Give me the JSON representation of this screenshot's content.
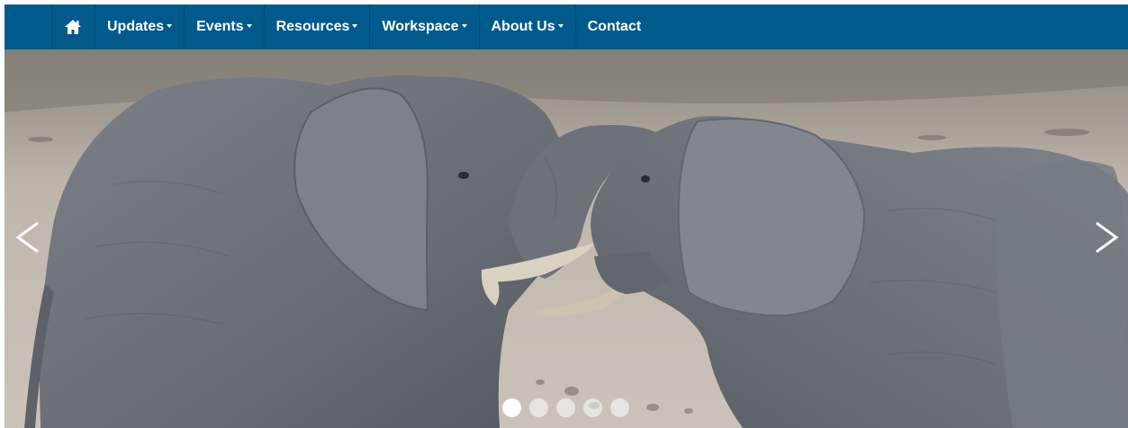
{
  "nav": {
    "home_icon": "home-icon",
    "items": [
      {
        "label": "Updates",
        "dropdown": true
      },
      {
        "label": "Events",
        "dropdown": true
      },
      {
        "label": "Resources",
        "dropdown": true
      },
      {
        "label": "Workspace",
        "dropdown": true
      },
      {
        "label": "About Us",
        "dropdown": true
      },
      {
        "label": "Contact",
        "dropdown": false
      }
    ]
  },
  "carousel": {
    "prev_symbol": "<",
    "next_symbol": ">",
    "slide_count": 5,
    "active_slide": 1
  },
  "colors": {
    "nav_background": "#005a8b",
    "nav_text": "#ffffff"
  }
}
